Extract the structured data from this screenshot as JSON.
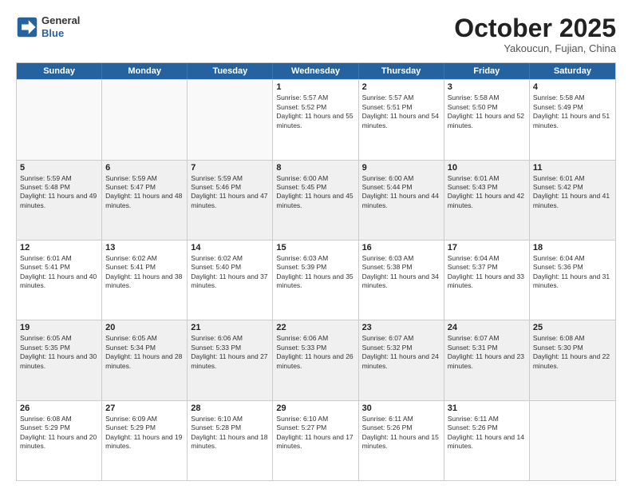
{
  "header": {
    "logo_line1": "General",
    "logo_line2": "Blue",
    "month": "October 2025",
    "location": "Yakoucun, Fujian, China"
  },
  "days_of_week": [
    "Sunday",
    "Monday",
    "Tuesday",
    "Wednesday",
    "Thursday",
    "Friday",
    "Saturday"
  ],
  "weeks": [
    [
      {
        "day": "",
        "info": ""
      },
      {
        "day": "",
        "info": ""
      },
      {
        "day": "",
        "info": ""
      },
      {
        "day": "1",
        "info": "Sunrise: 5:57 AM\nSunset: 5:52 PM\nDaylight: 11 hours and 55 minutes."
      },
      {
        "day": "2",
        "info": "Sunrise: 5:57 AM\nSunset: 5:51 PM\nDaylight: 11 hours and 54 minutes."
      },
      {
        "day": "3",
        "info": "Sunrise: 5:58 AM\nSunset: 5:50 PM\nDaylight: 11 hours and 52 minutes."
      },
      {
        "day": "4",
        "info": "Sunrise: 5:58 AM\nSunset: 5:49 PM\nDaylight: 11 hours and 51 minutes."
      }
    ],
    [
      {
        "day": "5",
        "info": "Sunrise: 5:59 AM\nSunset: 5:48 PM\nDaylight: 11 hours and 49 minutes."
      },
      {
        "day": "6",
        "info": "Sunrise: 5:59 AM\nSunset: 5:47 PM\nDaylight: 11 hours and 48 minutes."
      },
      {
        "day": "7",
        "info": "Sunrise: 5:59 AM\nSunset: 5:46 PM\nDaylight: 11 hours and 47 minutes."
      },
      {
        "day": "8",
        "info": "Sunrise: 6:00 AM\nSunset: 5:45 PM\nDaylight: 11 hours and 45 minutes."
      },
      {
        "day": "9",
        "info": "Sunrise: 6:00 AM\nSunset: 5:44 PM\nDaylight: 11 hours and 44 minutes."
      },
      {
        "day": "10",
        "info": "Sunrise: 6:01 AM\nSunset: 5:43 PM\nDaylight: 11 hours and 42 minutes."
      },
      {
        "day": "11",
        "info": "Sunrise: 6:01 AM\nSunset: 5:42 PM\nDaylight: 11 hours and 41 minutes."
      }
    ],
    [
      {
        "day": "12",
        "info": "Sunrise: 6:01 AM\nSunset: 5:41 PM\nDaylight: 11 hours and 40 minutes."
      },
      {
        "day": "13",
        "info": "Sunrise: 6:02 AM\nSunset: 5:41 PM\nDaylight: 11 hours and 38 minutes."
      },
      {
        "day": "14",
        "info": "Sunrise: 6:02 AM\nSunset: 5:40 PM\nDaylight: 11 hours and 37 minutes."
      },
      {
        "day": "15",
        "info": "Sunrise: 6:03 AM\nSunset: 5:39 PM\nDaylight: 11 hours and 35 minutes."
      },
      {
        "day": "16",
        "info": "Sunrise: 6:03 AM\nSunset: 5:38 PM\nDaylight: 11 hours and 34 minutes."
      },
      {
        "day": "17",
        "info": "Sunrise: 6:04 AM\nSunset: 5:37 PM\nDaylight: 11 hours and 33 minutes."
      },
      {
        "day": "18",
        "info": "Sunrise: 6:04 AM\nSunset: 5:36 PM\nDaylight: 11 hours and 31 minutes."
      }
    ],
    [
      {
        "day": "19",
        "info": "Sunrise: 6:05 AM\nSunset: 5:35 PM\nDaylight: 11 hours and 30 minutes."
      },
      {
        "day": "20",
        "info": "Sunrise: 6:05 AM\nSunset: 5:34 PM\nDaylight: 11 hours and 28 minutes."
      },
      {
        "day": "21",
        "info": "Sunrise: 6:06 AM\nSunset: 5:33 PM\nDaylight: 11 hours and 27 minutes."
      },
      {
        "day": "22",
        "info": "Sunrise: 6:06 AM\nSunset: 5:33 PM\nDaylight: 11 hours and 26 minutes."
      },
      {
        "day": "23",
        "info": "Sunrise: 6:07 AM\nSunset: 5:32 PM\nDaylight: 11 hours and 24 minutes."
      },
      {
        "day": "24",
        "info": "Sunrise: 6:07 AM\nSunset: 5:31 PM\nDaylight: 11 hours and 23 minutes."
      },
      {
        "day": "25",
        "info": "Sunrise: 6:08 AM\nSunset: 5:30 PM\nDaylight: 11 hours and 22 minutes."
      }
    ],
    [
      {
        "day": "26",
        "info": "Sunrise: 6:08 AM\nSunset: 5:29 PM\nDaylight: 11 hours and 20 minutes."
      },
      {
        "day": "27",
        "info": "Sunrise: 6:09 AM\nSunset: 5:29 PM\nDaylight: 11 hours and 19 minutes."
      },
      {
        "day": "28",
        "info": "Sunrise: 6:10 AM\nSunset: 5:28 PM\nDaylight: 11 hours and 18 minutes."
      },
      {
        "day": "29",
        "info": "Sunrise: 6:10 AM\nSunset: 5:27 PM\nDaylight: 11 hours and 17 minutes."
      },
      {
        "day": "30",
        "info": "Sunrise: 6:11 AM\nSunset: 5:26 PM\nDaylight: 11 hours and 15 minutes."
      },
      {
        "day": "31",
        "info": "Sunrise: 6:11 AM\nSunset: 5:26 PM\nDaylight: 11 hours and 14 minutes."
      },
      {
        "day": "",
        "info": ""
      }
    ]
  ]
}
